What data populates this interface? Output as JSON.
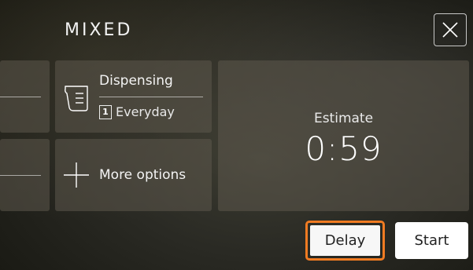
{
  "header": {
    "title": "MIXED"
  },
  "close_button": {
    "icon": "close-icon"
  },
  "dispensing": {
    "label": "Dispensing",
    "icon": "dispenser-cup-icon",
    "slot_number": "1",
    "detergent": "Everyday"
  },
  "more_options": {
    "label": "More options",
    "icon": "plus-icon"
  },
  "estimate": {
    "label": "Estimate",
    "value": "0:59"
  },
  "buttons": {
    "delay_label": "Delay",
    "start_label": "Start"
  },
  "colors": {
    "focus_outline": "#f07b22",
    "tile_background": "#5c584c",
    "button_background": "#ffffff"
  }
}
